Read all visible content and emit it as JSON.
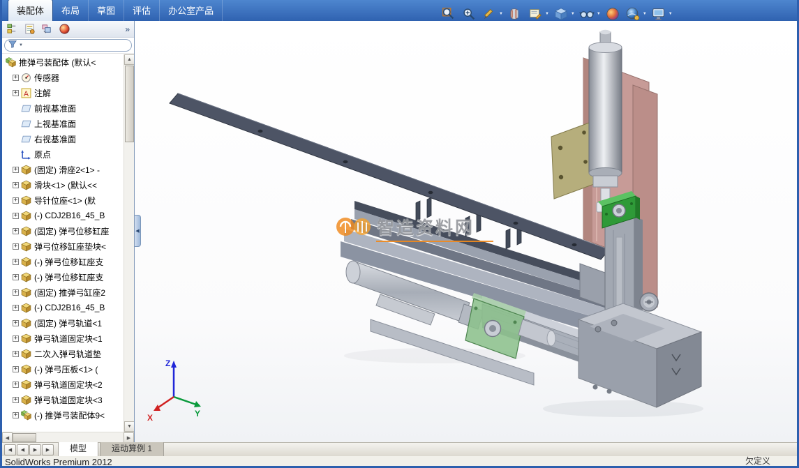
{
  "colors": {
    "frame_blue": "#2d5fae",
    "tabbar_gradient_top": "#4e86cf",
    "tabbar_gradient_bottom": "#2f62b0",
    "watermark_orange": "#f08a1e",
    "triad_x_red": "#d02020",
    "triad_y_green": "#0a9a3c",
    "triad_z_blue": "#2026d8"
  },
  "command_tabs": {
    "items": [
      {
        "label": "装配体",
        "active": true
      },
      {
        "label": "布局",
        "active": false
      },
      {
        "label": "草图",
        "active": false
      },
      {
        "label": "评估",
        "active": false
      },
      {
        "label": "办公室产品",
        "active": false
      }
    ]
  },
  "headsup_toolbar": {
    "buttons": [
      {
        "name": "zoom-to-fit",
        "dropdown": false
      },
      {
        "name": "zoom-to-area",
        "dropdown": false
      },
      {
        "name": "previous-view",
        "dropdown": true
      },
      {
        "name": "section-view",
        "dropdown": false
      },
      {
        "name": "annotation-view",
        "dropdown": true
      },
      {
        "name": "view-orientation",
        "dropdown": true
      },
      {
        "name": "display-style",
        "dropdown": true
      },
      {
        "name": "edit-appearance",
        "dropdown": false
      },
      {
        "name": "apply-scene",
        "dropdown": true
      },
      {
        "name": "view-settings",
        "dropdown": true
      }
    ]
  },
  "left_panel": {
    "toolbar": {
      "icons": [
        "featuremanager",
        "propertymanager",
        "configurationmanager",
        "displaymanager"
      ],
      "overflow_label": "»"
    },
    "tree": {
      "items": [
        {
          "label": "推弹弓装配体 (默认<",
          "icon": "assembly",
          "expand": false,
          "root": true
        },
        {
          "label": "传感器",
          "icon": "sensor",
          "expand": true
        },
        {
          "label": "注解",
          "icon": "annotation",
          "expand": true
        },
        {
          "label": "前视基准面",
          "icon": "plane",
          "expand": false
        },
        {
          "label": "上视基准面",
          "icon": "plane",
          "expand": false
        },
        {
          "label": "右视基准面",
          "icon": "plane",
          "expand": false
        },
        {
          "label": "原点",
          "icon": "origin",
          "expand": false
        },
        {
          "label": "(固定) 滑座2<1> -",
          "icon": "part",
          "expand": true
        },
        {
          "label": "滑块<1> (默认<<",
          "icon": "part",
          "expand": true
        },
        {
          "label": "导针位座<1> (默",
          "icon": "part",
          "expand": true
        },
        {
          "label": "(-) CDJ2B16_45_B",
          "icon": "part",
          "expand": true
        },
        {
          "label": "(固定) 弹弓位移缸座",
          "icon": "part",
          "expand": true
        },
        {
          "label": "弹弓位移缸座垫块<",
          "icon": "part",
          "expand": true
        },
        {
          "label": "(-) 弹弓位移缸座支",
          "icon": "part",
          "expand": true
        },
        {
          "label": "(-) 弹弓位移缸座支",
          "icon": "part",
          "expand": true
        },
        {
          "label": "(固定) 推弹弓缸座2",
          "icon": "part",
          "expand": true
        },
        {
          "label": "(-) CDJ2B16_45_B",
          "icon": "part",
          "expand": true
        },
        {
          "label": "(固定) 弹弓轨道<1",
          "icon": "part",
          "expand": true
        },
        {
          "label": "弹弓轨道固定块<1",
          "icon": "part",
          "expand": true
        },
        {
          "label": "二次入弹弓轨道垫",
          "icon": "part",
          "expand": true
        },
        {
          "label": "(-) 弹弓压板<1> (",
          "icon": "part",
          "expand": true
        },
        {
          "label": "弹弓轨道固定块<2",
          "icon": "part",
          "expand": true
        },
        {
          "label": "弹弓轨道固定块<3",
          "icon": "part",
          "expand": true
        },
        {
          "label": "(-) 推弹弓装配体9<",
          "icon": "assembly",
          "expand": true
        }
      ]
    }
  },
  "viewport": {
    "watermark_text": "智造资料网",
    "triad_labels": {
      "x": "X",
      "y": "Y",
      "z": "Z"
    }
  },
  "sheet_bar": {
    "tabs": [
      {
        "label": "模型",
        "active": true
      },
      {
        "label": "运动算例 1",
        "active": false
      }
    ]
  },
  "status_bar": {
    "left": "SolidWorks Premium 2012",
    "right": "欠定义"
  }
}
